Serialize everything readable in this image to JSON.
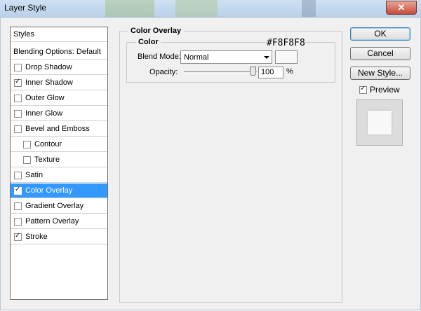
{
  "window": {
    "title": "Layer Style",
    "close_glyph": "✕"
  },
  "styles_list": {
    "header": "Styles",
    "blending_options": "Blending Options: Default",
    "items": [
      {
        "label": "Drop Shadow",
        "checked": false,
        "sub": false,
        "selected": false
      },
      {
        "label": "Inner Shadow",
        "checked": true,
        "sub": false,
        "selected": false
      },
      {
        "label": "Outer Glow",
        "checked": false,
        "sub": false,
        "selected": false
      },
      {
        "label": "Inner Glow",
        "checked": false,
        "sub": false,
        "selected": false
      },
      {
        "label": "Bevel and Emboss",
        "checked": false,
        "sub": false,
        "selected": false
      },
      {
        "label": "Contour",
        "checked": false,
        "sub": true,
        "selected": false
      },
      {
        "label": "Texture",
        "checked": false,
        "sub": true,
        "selected": false
      },
      {
        "label": "Satin",
        "checked": false,
        "sub": false,
        "selected": false
      },
      {
        "label": "Color Overlay",
        "checked": true,
        "sub": false,
        "selected": true
      },
      {
        "label": "Gradient Overlay",
        "checked": false,
        "sub": false,
        "selected": false
      },
      {
        "label": "Pattern Overlay",
        "checked": false,
        "sub": false,
        "selected": false
      },
      {
        "label": "Stroke",
        "checked": true,
        "sub": false,
        "selected": false
      }
    ]
  },
  "color_overlay": {
    "group_title": "Color Overlay",
    "sub_title": "Color",
    "blend_mode_label": "Blend Mode:",
    "blend_mode_value": "Normal",
    "swatch_color": "#F8F8F8",
    "hex_annotation": "#F8F8F8",
    "opacity_label": "Opacity:",
    "opacity_value": "100",
    "opacity_unit": "%"
  },
  "buttons": {
    "ok": "OK",
    "cancel": "Cancel",
    "new_style": "New Style...",
    "preview_label": "Preview",
    "preview_checked": true
  }
}
